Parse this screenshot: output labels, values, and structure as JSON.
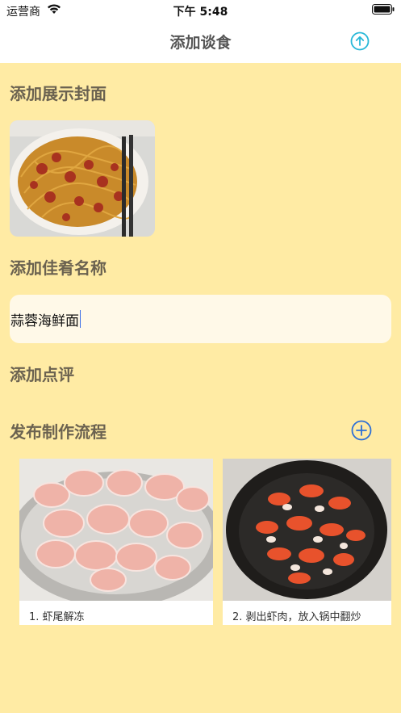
{
  "status_bar": {
    "carrier": "运营商",
    "time": "下午 5:48"
  },
  "nav": {
    "title": "添加谈食",
    "upload_icon": "upload-icon"
  },
  "sections": {
    "cover_title": "添加展示封面",
    "name_title": "添加佳肴名称",
    "review_title": "添加点评",
    "process_title": "发布制作流程"
  },
  "name_input": {
    "value": "蒜蓉海鲜面"
  },
  "steps": [
    {
      "caption": "1. 虾尾解冻"
    },
    {
      "caption": "2. 剥出虾肉，放入锅中翻炒"
    }
  ],
  "colors": {
    "background": "#ffeba4",
    "accent": "#28b8d8",
    "add_icon": "#2d6fd6",
    "section_text": "#6b6250"
  }
}
